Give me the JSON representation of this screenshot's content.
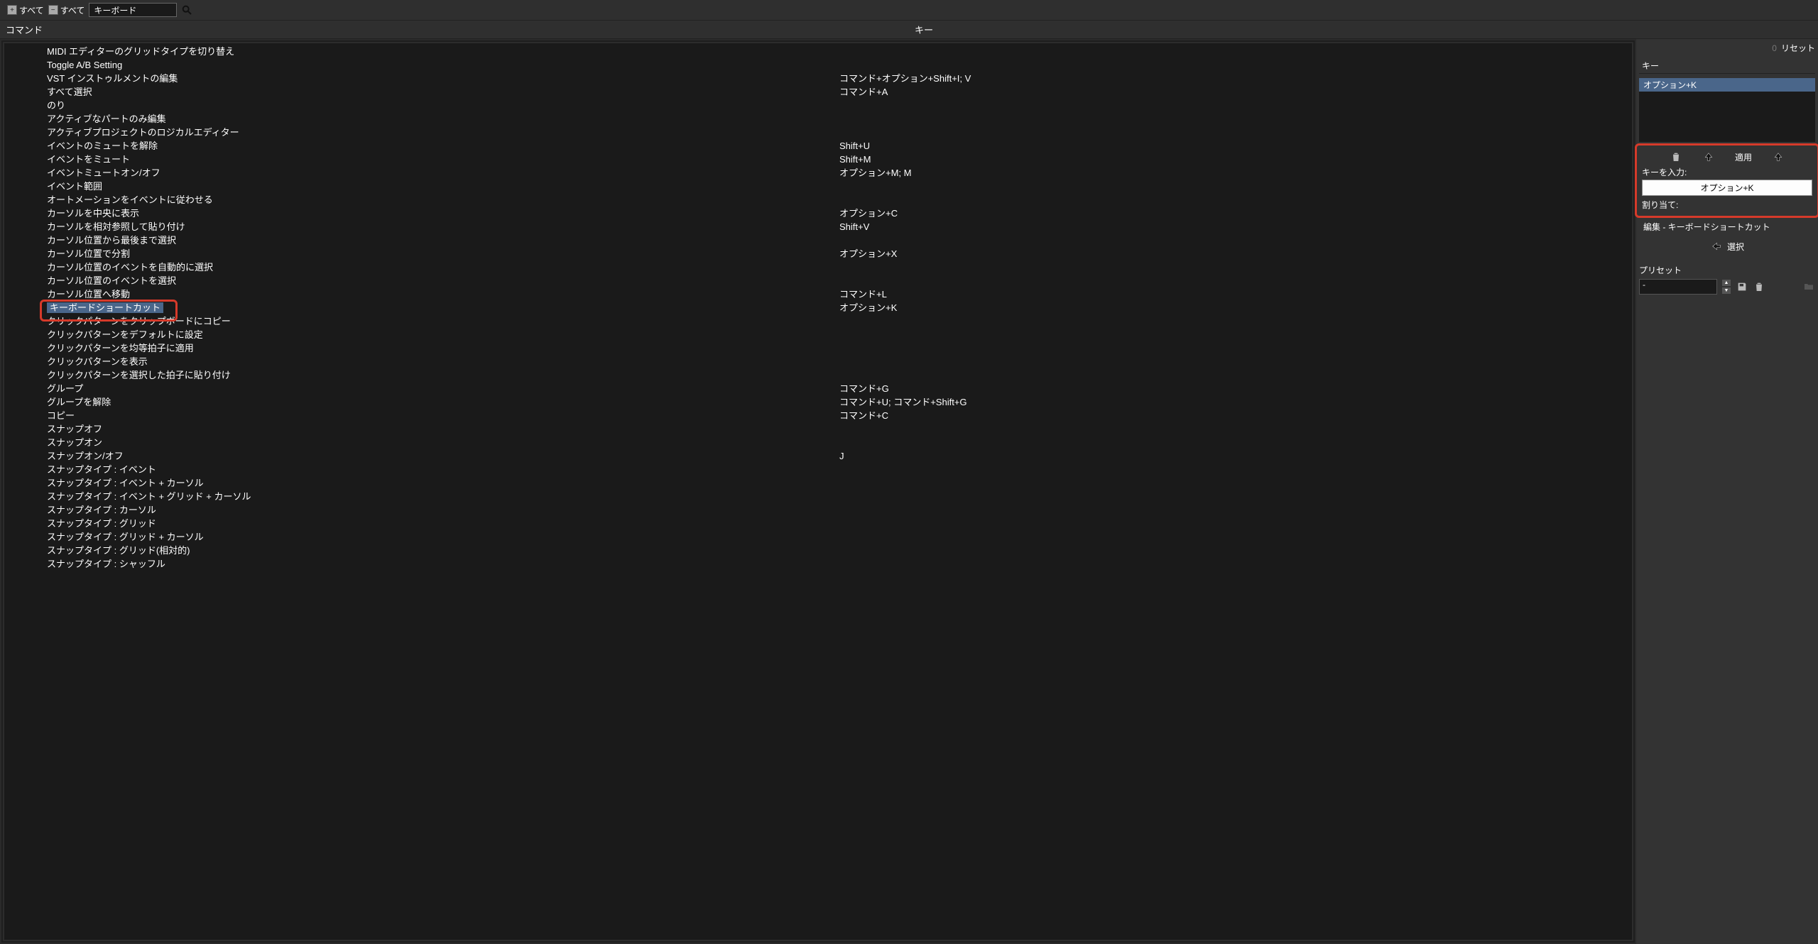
{
  "topbar": {
    "expand_all_label": "すべて",
    "collapse_all_label": "すべて",
    "search_value": "キーボード"
  },
  "header": {
    "command_col": "コマンド",
    "key_col": "キー"
  },
  "commands": [
    {
      "name": "MIDI エディターのグリッドタイプを切り替え",
      "key": ""
    },
    {
      "name": "Toggle A/B Setting",
      "key": ""
    },
    {
      "name": "VST インストゥルメントの編集",
      "key": "コマンド+オプション+Shift+I; V"
    },
    {
      "name": "すべて選択",
      "key": "コマンド+A"
    },
    {
      "name": "のり",
      "key": ""
    },
    {
      "name": "アクティブなパートのみ編集",
      "key": ""
    },
    {
      "name": "アクティブプロジェクトのロジカルエディター",
      "key": ""
    },
    {
      "name": "イベントのミュートを解除",
      "key": "Shift+U"
    },
    {
      "name": "イベントをミュート",
      "key": "Shift+M"
    },
    {
      "name": "イベントミュートオン/オフ",
      "key": "オプション+M; M"
    },
    {
      "name": "イベント範囲",
      "key": ""
    },
    {
      "name": "オートメーションをイベントに従わせる",
      "key": ""
    },
    {
      "name": "カーソルを中央に表示",
      "key": "オプション+C"
    },
    {
      "name": "カーソルを相対参照して貼り付け",
      "key": "Shift+V"
    },
    {
      "name": "カーソル位置から最後まで選択",
      "key": ""
    },
    {
      "name": "カーソル位置で分割",
      "key": "オプション+X"
    },
    {
      "name": "カーソル位置のイベントを自動的に選択",
      "key": ""
    },
    {
      "name": "カーソル位置のイベントを選択",
      "key": ""
    },
    {
      "name": "カーソル位置へ移動",
      "key": "コマンド+L"
    },
    {
      "name": "キーボードショートカット",
      "key": "オプション+K",
      "selected": true
    },
    {
      "name": "クリックパターンをクリップボードにコピー",
      "key": ""
    },
    {
      "name": "クリックパターンをデフォルトに設定",
      "key": ""
    },
    {
      "name": "クリックパターンを均等拍子に適用",
      "key": ""
    },
    {
      "name": "クリックパターンを表示",
      "key": ""
    },
    {
      "name": "クリックパターンを選択した拍子に貼り付け",
      "key": ""
    },
    {
      "name": "グループ",
      "key": "コマンド+G"
    },
    {
      "name": "グループを解除",
      "key": "コマンド+U; コマンド+Shift+G"
    },
    {
      "name": "コピー",
      "key": "コマンド+C"
    },
    {
      "name": "スナップオフ",
      "key": ""
    },
    {
      "name": "スナップオン",
      "key": ""
    },
    {
      "name": "スナップオン/オフ",
      "key": "J"
    },
    {
      "name": "スナップタイプ : イベント",
      "key": ""
    },
    {
      "name": "スナップタイプ : イベント + カーソル",
      "key": ""
    },
    {
      "name": "スナップタイプ : イベント + グリッド + カーソル",
      "key": ""
    },
    {
      "name": "スナップタイプ : カーソル",
      "key": ""
    },
    {
      "name": "スナップタイプ : グリッド",
      "key": ""
    },
    {
      "name": "スナップタイプ : グリッド + カーソル",
      "key": ""
    },
    {
      "name": "スナップタイプ : グリッド(相対的)",
      "key": ""
    },
    {
      "name": "スナップタイプ : シャッフル",
      "key": ""
    }
  ],
  "side": {
    "reset_label": "リセット",
    "key_header": "キー",
    "assigned_key_item": "オプション+K",
    "apply_label": "適用",
    "key_input_label": "キーを入力:",
    "key_input_value": "オプション+K",
    "assign_label": "割り当て:",
    "assigned_to": "編集 - キーボードショートカット",
    "select_label": "選択",
    "preset_label": "プリセット",
    "preset_value": "-"
  }
}
